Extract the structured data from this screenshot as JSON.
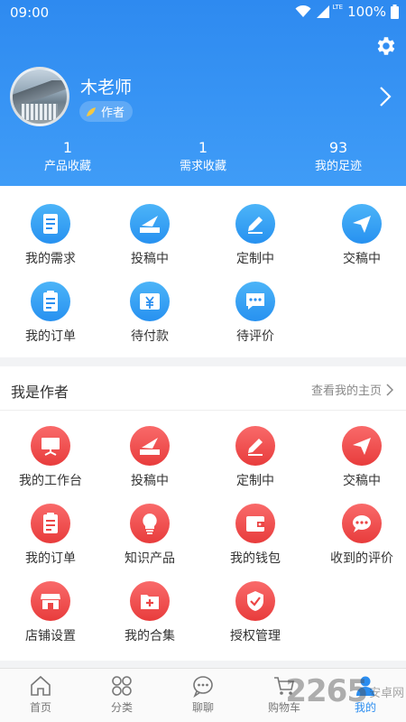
{
  "status_bar": {
    "time": "09:00",
    "network": "LTE",
    "battery": "100%"
  },
  "profile": {
    "name": "木老师",
    "role": "作者"
  },
  "stats": [
    {
      "value": "1",
      "label": "产品收藏"
    },
    {
      "value": "1",
      "label": "需求收藏"
    },
    {
      "value": "93",
      "label": "我的足迹"
    }
  ],
  "orders": [
    {
      "label": "我的需求",
      "icon": "document-icon"
    },
    {
      "label": "投稿中",
      "icon": "paper-plane-envelope-icon"
    },
    {
      "label": "定制中",
      "icon": "pencil-icon"
    },
    {
      "label": "交稿中",
      "icon": "send-icon"
    },
    {
      "label": "我的订单",
      "icon": "clipboard-icon"
    },
    {
      "label": "待付款",
      "icon": "yen-card-icon"
    },
    {
      "label": "待评价",
      "icon": "chat-bubble-icon"
    }
  ],
  "author_section": {
    "title": "我是作者",
    "link": "查看我的主页",
    "items": [
      {
        "label": "我的工作台",
        "icon": "workbench-icon"
      },
      {
        "label": "投稿中",
        "icon": "paper-plane-envelope-icon"
      },
      {
        "label": "定制中",
        "icon": "pencil-icon"
      },
      {
        "label": "交稿中",
        "icon": "send-icon"
      },
      {
        "label": "我的订单",
        "icon": "clipboard-icon"
      },
      {
        "label": "知识产品",
        "icon": "lightbulb-icon"
      },
      {
        "label": "我的钱包",
        "icon": "wallet-icon"
      },
      {
        "label": "收到的评价",
        "icon": "chat-bubble-icon"
      },
      {
        "label": "店铺设置",
        "icon": "storefront-icon"
      },
      {
        "label": "我的合集",
        "icon": "folder-plus-icon"
      },
      {
        "label": "授权管理",
        "icon": "shield-check-icon"
      }
    ]
  },
  "tabs": [
    {
      "label": "首页",
      "icon": "home-icon"
    },
    {
      "label": "分类",
      "icon": "category-icon"
    },
    {
      "label": "聊聊",
      "icon": "chat-icon"
    },
    {
      "label": "购物车",
      "icon": "cart-icon"
    },
    {
      "label": "我的",
      "icon": "user-icon",
      "active": true
    }
  ],
  "watermark": {
    "number": "2265",
    "text": "安卓网"
  },
  "colors": {
    "primary": "#2e8af0",
    "author_red": "#ef4b4b",
    "tab_active": "#2a8df0"
  }
}
